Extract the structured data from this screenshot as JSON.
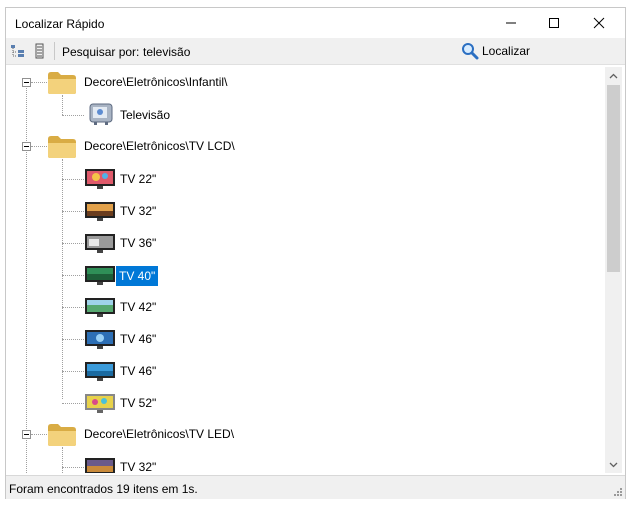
{
  "window": {
    "title": "Localizar Rápido",
    "minimize_glyph": "—",
    "maximize_glyph": "☐",
    "close_glyph": "✕"
  },
  "toolbar": {
    "search_label": "Pesquisar por:",
    "search_value": "televisão",
    "find_label": "Localizar",
    "icons": [
      "expand-tree-icon",
      "collapse-tree-icon",
      "search-icon"
    ]
  },
  "tree": {
    "groups": [
      {
        "label": "Decore\\Eletrônicos\\Infantil\\",
        "items": [
          {
            "label": "Televisão",
            "icon": "kids-tv-icon"
          }
        ]
      },
      {
        "label": "Decore\\Eletrônicos\\TV LCD\\",
        "items": [
          {
            "label": "TV 22\"",
            "icon": "tv-icon"
          },
          {
            "label": "TV 32\"",
            "icon": "tv-icon"
          },
          {
            "label": "TV 36\"",
            "icon": "tv-icon"
          },
          {
            "label": "TV 40\"",
            "icon": "tv-icon",
            "selected": true
          },
          {
            "label": "TV 42\"",
            "icon": "tv-icon"
          },
          {
            "label": "TV 46\"",
            "icon": "tv-icon"
          },
          {
            "label": "TV 46\"",
            "icon": "tv-icon"
          },
          {
            "label": "TV 52\"",
            "icon": "tv-icon"
          }
        ]
      },
      {
        "label": "Decore\\Eletrônicos\\TV LED\\",
        "items": [
          {
            "label": "TV 32\"",
            "icon": "tv-icon"
          }
        ]
      }
    ]
  },
  "status": {
    "text": "Foram encontrados 19 itens em 1s."
  },
  "colors": {
    "selection": "#0078d7",
    "folder": "#e8c56a",
    "chrome": "#f0f0f0"
  }
}
